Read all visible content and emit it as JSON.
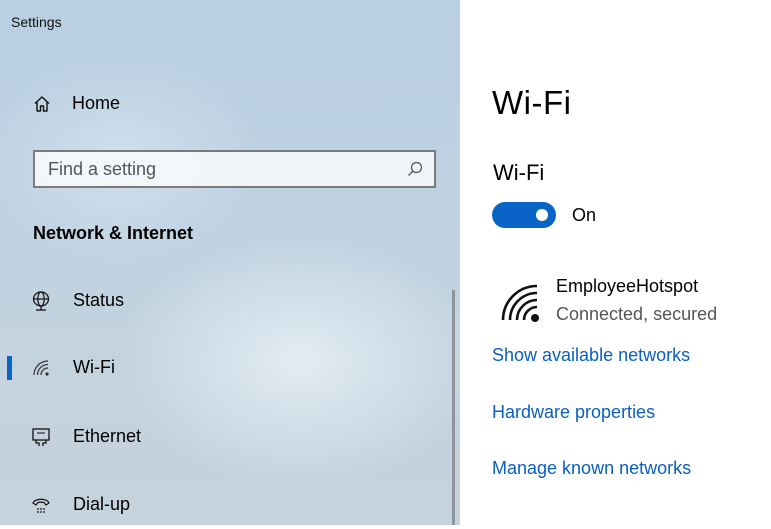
{
  "window": {
    "title": "Settings"
  },
  "sidebar": {
    "home_label": "Home",
    "search": {
      "placeholder": "Find a setting",
      "value": ""
    },
    "section_title": "Network & Internet",
    "items": [
      {
        "label": "Status",
        "icon": "globe-icon",
        "selected": false
      },
      {
        "label": "Wi-Fi",
        "icon": "wifi-icon",
        "selected": true
      },
      {
        "label": "Ethernet",
        "icon": "ethernet-icon",
        "selected": false
      },
      {
        "label": "Dial-up",
        "icon": "dialup-icon",
        "selected": false
      }
    ]
  },
  "main": {
    "title": "Wi-Fi",
    "wifi_section_title": "Wi-Fi",
    "toggle": {
      "state": "On",
      "on": true
    },
    "network": {
      "name": "EmployeeHotspot",
      "status": "Connected, secured",
      "icon": "wifi-connected-icon"
    },
    "links": [
      {
        "label": "Show available networks"
      },
      {
        "label": "Hardware properties"
      },
      {
        "label": "Manage known networks"
      }
    ]
  },
  "colors": {
    "accent": "#0a64c8",
    "link": "#0a5fbf"
  }
}
